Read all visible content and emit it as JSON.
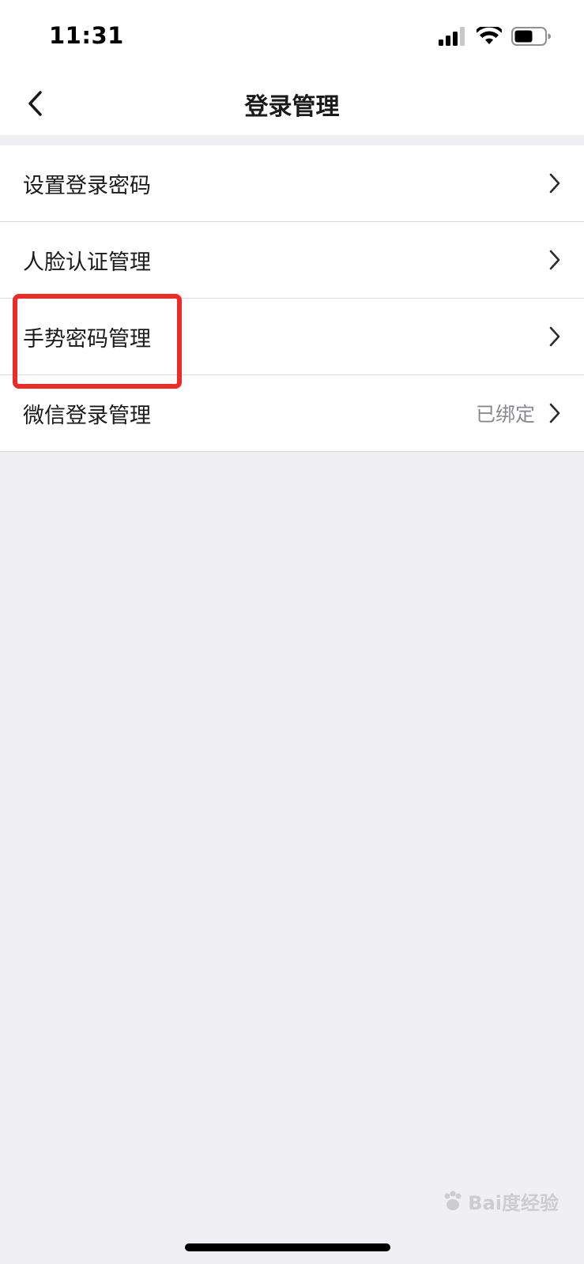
{
  "status_bar": {
    "time": "11:31",
    "icons": [
      "signal-icon",
      "wifi-icon",
      "battery-icon"
    ]
  },
  "nav": {
    "title": "登录管理",
    "back_icon": "chevron-left-icon"
  },
  "list": {
    "items": [
      {
        "label": "设置登录密码",
        "value": ""
      },
      {
        "label": "人脸认证管理",
        "value": ""
      },
      {
        "label": "手势密码管理",
        "value": ""
      },
      {
        "label": "微信登录管理",
        "value": "已绑定"
      }
    ]
  },
  "watermark": {
    "text": "Bai度经验"
  },
  "colors": {
    "background": "#efeff4",
    "highlight": "#ee2a24",
    "secondary_text": "#8a8a8e"
  }
}
